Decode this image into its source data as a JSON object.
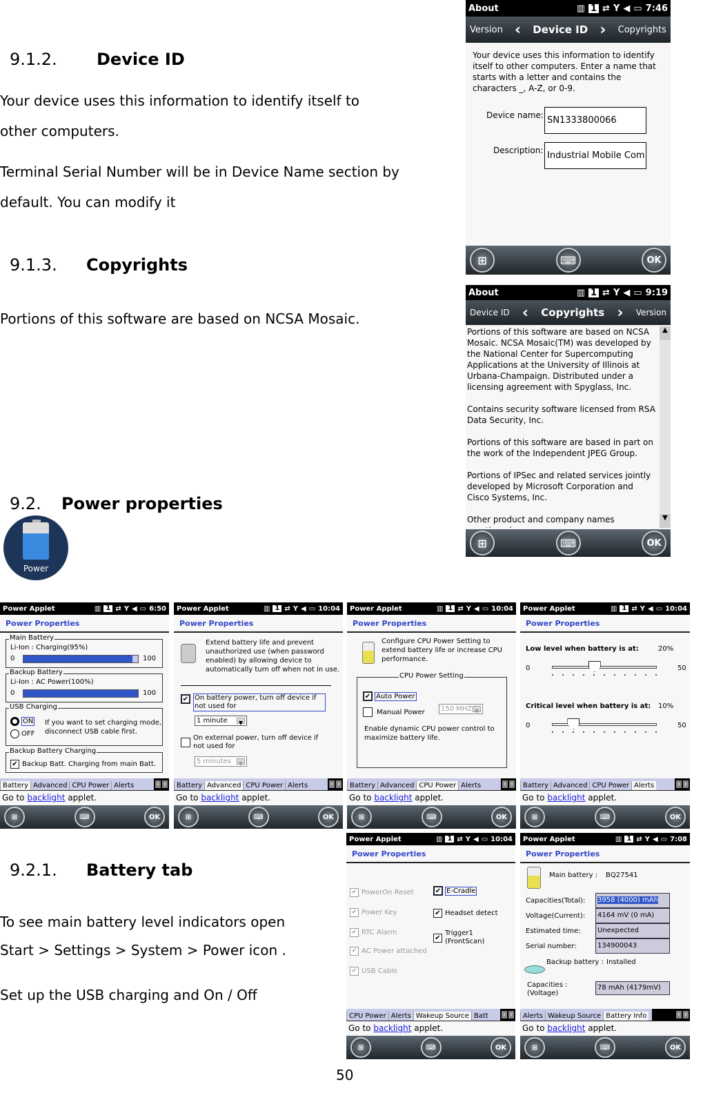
{
  "doc": {
    "s912_num": "9.1.2.",
    "s912_title": "Device ID",
    "s912_p1a": "Your device uses this information to identify itself to",
    "s912_p1b": "other computers.",
    "s912_p2a": "Terminal Serial Number will be in Device Name section by",
    "s912_p2b": "default. You can modify it",
    "s913_num": "9.1.3.",
    "s913_title": "Copyrights",
    "s913_p1": "Portions of this software are based on NCSA Mosaic.",
    "s92_num": "9.2.",
    "s92_title": "Power properties",
    "power_icon_label": "Power",
    "s921_num": "9.2.1.",
    "s921_title": "Battery tab",
    "s921_p1a": "To see main battery level indicators open",
    "s921_p1b": "Start > Settings > System > Power icon .",
    "s921_p2": "Set up the USB charging and On / Off",
    "page_number": "50"
  },
  "common": {
    "one": "1",
    "power_applet": "Power Applet",
    "power_properties": "Power Properties",
    "goto_prefix": "Go to ",
    "goto_link": "backlight",
    "goto_suffix": " applet.",
    "ok": "OK",
    "about": "About"
  },
  "deviceid_screen": {
    "time": "7:46",
    "nav_prev": "Version",
    "nav_cur": "Device ID",
    "nav_next": "Copyrights",
    "desc": "Your device uses this information to identify itself to other computers. Enter a name that starts with a letter and contains the characters _, A-Z, or 0-9.",
    "name_label": "Device name:",
    "name_value": "SN1333800066",
    "desc_label": "Description:",
    "desc_value": "Industrial Mobile Com"
  },
  "copyrights_screen": {
    "time": "9:19",
    "nav_prev": "Device ID",
    "nav_cur": "Copyrights",
    "nav_next": "Version",
    "paragraphs": [
      "Portions of this software are based on NCSA Mosaic. NCSA Mosaic(TM) was developed by the National Center for Supercomputing Applications at the University of Illinois at Urbana-Champaign. Distributed under a licensing agreement with Spyglass, Inc.",
      "Contains security software licensed from RSA Data Security, Inc.",
      "Portions of this software are based in part on the work of the Independent JPEG Group.",
      "Portions of IPSec and related services jointly developed by Microsoft Corporation and Cisco Systems, Inc.",
      "Other product and company names mentioned"
    ]
  },
  "battery_screen": {
    "time": "6:50",
    "main_battery": "Main Battery",
    "main_status": "Li-Ion : Charging(95%)",
    "main_level": 95,
    "backup_battery": "Backup Battery",
    "backup_status": "Li-Ion : AC Power(100%)",
    "backup_level": 100,
    "min": "0",
    "max": "100",
    "usb_charging": "USB Charging",
    "on": "ON",
    "off": "OFF",
    "usb_note": "If you want to set charging mode, disconnect USB cable first.",
    "backup_charging": "Backup Battery Charging",
    "backup_charging_opt": "Backup Batt. Charging from main Batt.",
    "tabs": [
      "Battery",
      "Advanced",
      "CPU Power",
      "Alerts"
    ]
  },
  "advanced_screen": {
    "time": "10:04",
    "desc": "Extend battery life and prevent unauthorized use (when password enabled) by allowing device to automatically turn off when not in use.",
    "opt1": "On battery power, turn off device if not used for",
    "opt1_value": "1 minute",
    "opt2": "On external power, turn off device if not used for",
    "opt2_value": "5 minutes",
    "tabs": [
      "Battery",
      "Advanced",
      "CPU Power",
      "Alerts"
    ]
  },
  "cpu_screen": {
    "time": "10:04",
    "desc": "Configure CPU Power Setting to extend battery life or increase CPU performance.",
    "group": "CPU Power Setting",
    "auto": "Auto Power",
    "manual": "Manual Power",
    "freq": "150 MHZ",
    "note": "Enable dynamic CPU power control to maximize battery life.",
    "tabs": [
      "Battery",
      "Advanced",
      "CPU Power",
      "Alerts"
    ]
  },
  "alerts_screen": {
    "time": "10:04",
    "low_label": "Low level when battery is at:",
    "low_value": "20%",
    "low_level": 20,
    "crit_label": "Critical level when battery is at:",
    "crit_value": "10%",
    "crit_level": 10,
    "min": "0",
    "max": "50",
    "tabs": [
      "Battery",
      "Advanced",
      "CPU Power",
      "Alerts"
    ]
  },
  "wakeup_screen": {
    "time": "10:04",
    "left": [
      "PowerOn Reset",
      "Power Key",
      "RTC Alarm",
      "AC Power attached",
      "USB Cable"
    ],
    "right": [
      "E-Cradle",
      "Headset detect",
      "Trigger1 (FrontScan)"
    ],
    "tabs": [
      "CPU Power",
      "Alerts",
      "Wakeup Source",
      "Batt"
    ]
  },
  "batinfo_screen": {
    "time": "7:08",
    "main_label": "Main battery :",
    "main_value": "BQ27541",
    "rows": [
      {
        "label": "Capacities(Total):",
        "value": "3958 (4000) mAh"
      },
      {
        "label": "Voltage(Current):",
        "value": "4164 mV (0 mA)"
      },
      {
        "label": "Estimated time:",
        "value": "Unexpected"
      },
      {
        "label": "Serial number:",
        "value": "134900043"
      }
    ],
    "backup_label": "Backup battery :",
    "backup_value": "Installed",
    "cap_label1": "Capacities :",
    "cap_label2": "(Voltage)",
    "cap_value": "78 mAh (4179mV)",
    "tabs": [
      "Alerts",
      "Wakeup Source",
      "Battery Info"
    ]
  }
}
